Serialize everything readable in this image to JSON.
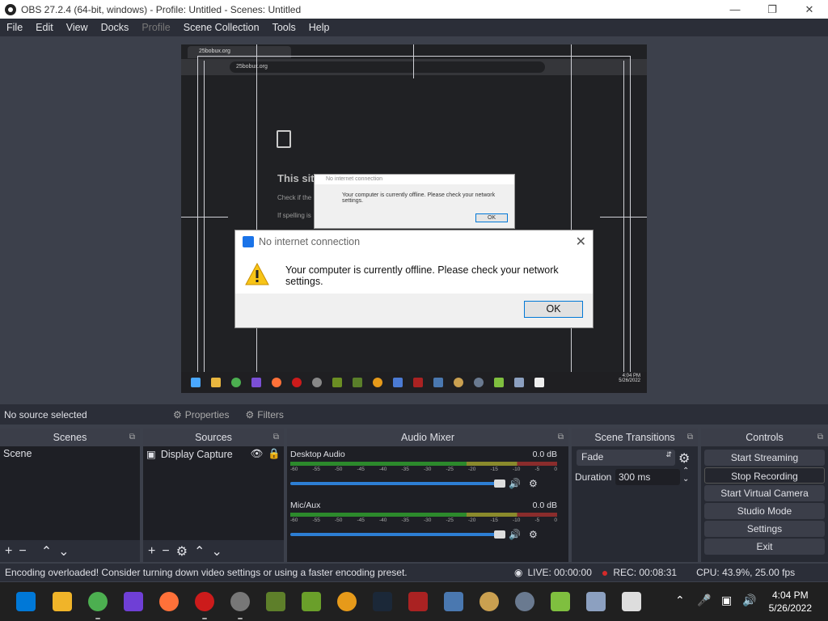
{
  "window": {
    "title": "OBS 27.2.4 (64-bit, windows) - Profile: Untitled - Scenes: Untitled"
  },
  "menu": [
    "File",
    "Edit",
    "View",
    "Docks",
    "Profile",
    "Scene Collection",
    "Tools",
    "Help"
  ],
  "preview": {
    "browser_tab": "25bobux.org",
    "browser_url": "25bobux.org",
    "page_heading": "This sit",
    "page_line1": "Check if the",
    "page_line2": "If spelling is",
    "small_dialog": {
      "title": "No internet connection",
      "message": "Your computer is currently offline. Please check your network settings.",
      "ok": "OK"
    },
    "inner_time": "4:04 PM",
    "inner_date": "5/26/2022"
  },
  "dialog": {
    "title": "No internet connection",
    "message": "Your computer is currently offline. Please check your network settings.",
    "ok": "OK"
  },
  "selbar": {
    "no_source": "No source selected",
    "properties": "Properties",
    "filters": "Filters"
  },
  "scenes": {
    "header": "Scenes",
    "items": [
      "Scene"
    ]
  },
  "sources": {
    "header": "Sources",
    "items": [
      "Display Capture"
    ]
  },
  "mixer": {
    "header": "Audio Mixer",
    "channels": [
      {
        "name": "Desktop Audio",
        "db": "0.0 dB",
        "level": 0.0,
        "volume": 0.93
      },
      {
        "name": "Mic/Aux",
        "db": "0.0 dB",
        "level": 0.2,
        "volume": 0.93
      }
    ],
    "ticks": [
      "-60",
      "-55",
      "-50",
      "-45",
      "-40",
      "-35",
      "-30",
      "-25",
      "-20",
      "-15",
      "-10",
      "-5",
      "0"
    ]
  },
  "transitions": {
    "header": "Scene Transitions",
    "type": "Fade",
    "duration_label": "Duration",
    "duration": "300 ms"
  },
  "controls": {
    "header": "Controls",
    "buttons": [
      "Start Streaming",
      "Stop Recording",
      "Start Virtual Camera",
      "Studio Mode",
      "Settings",
      "Exit"
    ]
  },
  "status": {
    "message": "Encoding overloaded! Consider turning down video settings or using a faster encoding preset.",
    "live": "LIVE: 00:00:00",
    "rec": "REC: 00:08:31",
    "cpu": "CPU: 43.9%, 25.00 fps"
  },
  "taskbar": {
    "time": "4:04 PM",
    "date": "5/26/2022"
  }
}
